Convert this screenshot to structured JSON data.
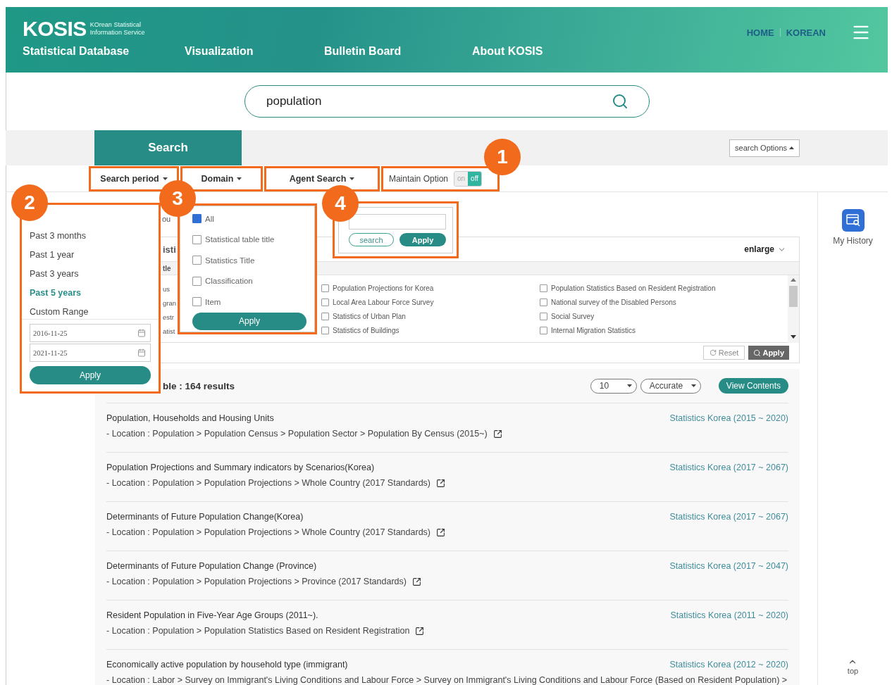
{
  "header": {
    "logo": "KOSIS",
    "logo_sub": [
      "KOrean Statistical",
      "Information Service"
    ],
    "nav": [
      "Statistical Database",
      "Visualization",
      "Bulletin Board",
      "About KOSIS"
    ],
    "links": [
      "HOME",
      "KOREAN"
    ]
  },
  "search": {
    "value": "population"
  },
  "search_tab": {
    "label": "Search",
    "selected": true
  },
  "search_options": "search Options",
  "filters": [
    {
      "label": "Search period"
    },
    {
      "label": "Domain"
    },
    {
      "label": "Agent Search"
    }
  ],
  "maintain_option": {
    "label": "Maintain Option",
    "on_label": "on",
    "off_label": "off",
    "on": false
  },
  "top_fragment": "ou",
  "panel": {
    "title_fragment": "isti",
    "enlarge": "enlarge",
    "subheader_fragment": "tle",
    "rows": [
      {
        "fragment": "us",
        "items": [
          {
            "label": "Population Projections for Korea",
            "checked": false
          },
          {
            "label": "Population Statistics Based on Resident Registration",
            "checked": false
          }
        ]
      },
      {
        "fragment": "gran",
        "items": [
          {
            "label": "Local Area Labour Force Survey",
            "checked": false
          },
          {
            "label": "National survey of the Disabled Persons",
            "checked": false
          }
        ]
      },
      {
        "fragment": "estr",
        "items": [
          {
            "label": "Statistics of Urban Plan",
            "checked": false
          },
          {
            "label": "Social Survey",
            "checked": false
          }
        ]
      },
      {
        "fragment": "atist",
        "items": [
          {
            "label": "Statistics of Buildings",
            "checked": false
          },
          {
            "label": "Internal Migration Statistics",
            "checked": false
          }
        ]
      }
    ],
    "reset": "Reset",
    "apply": "Apply"
  },
  "results": {
    "count_text": "ble : 164 results",
    "page_size": "10",
    "sort": "Accurate",
    "view_button": "View Contents",
    "items": [
      {
        "title": "Population, Households and Housing Units",
        "location": "- Location : Population > Population Census > Population Sector > Population By Census (2015~)",
        "source": "Statistics Korea (2015 ~ 2020)",
        "link": true
      },
      {
        "title": "Population Projections and Summary indicators by Scenarios(Korea)",
        "location": "- Location : Population > Population Projections > Whole Country (2017 Standards)",
        "source": "Statistics Korea (2017 ~ 2067)",
        "link": true
      },
      {
        "title": "Determinants of Future Population Change(Korea)",
        "location": "- Location : Population > Population Projections > Whole Country (2017 Standards)",
        "source": "Statistics Korea (2017 ~ 2067)",
        "link": true
      },
      {
        "title": "Determinants of Future Population Change (Province)",
        "location": "- Location : Population > Population Projections > Province (2017 Standards)",
        "source": "Statistics Korea (2017 ~ 2047)",
        "link": true
      },
      {
        "title": "Resident Population in Five-Year Age Groups (2011~).",
        "location": "- Location : Population > Population Statistics Based on Resident Registration",
        "source": "Statistics Korea (2011 ~ 2020)",
        "link": true
      },
      {
        "title": "Economically active population by household type (immigrant)",
        "location": "- Location : Labor > Survey on Immigrant's Living Conditions and Labour Force > Survey on Immigrant's Living Conditions and Labour Force (Based on Resident Population) >",
        "source": "Statistics Korea (2012 ~ 2020)",
        "link": false
      }
    ]
  },
  "period_popover": {
    "options": [
      {
        "label": "Past 3 months",
        "selected": false
      },
      {
        "label": "Past 1 year",
        "selected": false
      },
      {
        "label": "Past 3 years",
        "selected": false
      },
      {
        "label": "Past 5 years",
        "selected": true
      },
      {
        "label": "Custom Range",
        "selected": false
      }
    ],
    "from": "2016-11-25",
    "to": "2021-11-25",
    "apply": "Apply"
  },
  "domain_popover": {
    "options": [
      {
        "label": "All",
        "checked": true
      },
      {
        "label": "Statistical table title",
        "checked": false
      },
      {
        "label": "Statistics Title",
        "checked": false
      },
      {
        "label": "Classification",
        "checked": false
      },
      {
        "label": "Item",
        "checked": false
      }
    ],
    "apply": "Apply"
  },
  "agent_popover": {
    "search": "search",
    "apply": "Apply"
  },
  "annotations": [
    "1",
    "2",
    "3",
    "4"
  ],
  "sidebar": {
    "history": "My History",
    "top": "top"
  }
}
